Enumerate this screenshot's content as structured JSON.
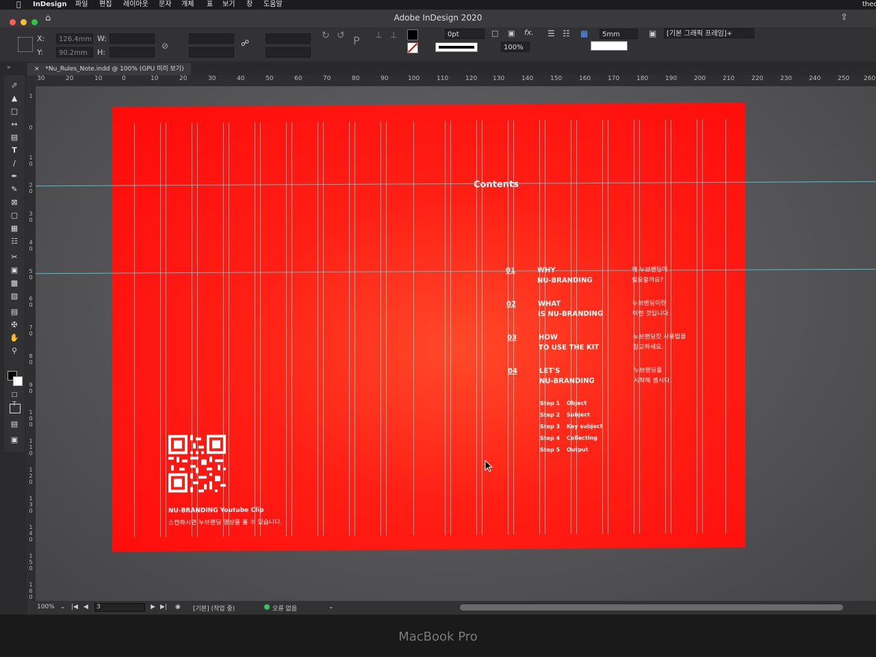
{
  "menubar": {
    "app": "InDesign",
    "items": [
      "파일",
      "편집",
      "레이아웃",
      "문자",
      "개체",
      "표",
      "보기",
      "창",
      "도움말"
    ],
    "right_text": "theo"
  },
  "window": {
    "title": "Adobe InDesign 2020"
  },
  "control": {
    "x_label": "X:",
    "x_value": "126.4mm",
    "y_label": "Y:",
    "y_value": "90.2mm",
    "w_label": "W:",
    "h_label": "H:",
    "stroke_weight": "0pt",
    "zoom": "100%",
    "gutter": "5mm",
    "style_select": "[기본 그래픽 프레임]+"
  },
  "tab": {
    "label": "*Nu_Rules_Note.indd @ 100% (GPU 미리 보기)",
    "close": "×"
  },
  "ruler": {
    "h_labels": [
      "30",
      "20",
      "10",
      "0",
      "10",
      "20",
      "30",
      "40",
      "50",
      "60",
      "70",
      "80",
      "90",
      "100",
      "110",
      "120",
      "130",
      "140",
      "150",
      "160",
      "170",
      "180",
      "190",
      "200",
      "210",
      "220",
      "230",
      "240",
      "250",
      "260"
    ],
    "v_labels": [
      "1",
      "0",
      "1 0",
      "2 0",
      "3 0",
      "4 0",
      "5 0",
      "6 0",
      "7 0",
      "8 0",
      "9 0",
      "1 0 0",
      "1 1 0",
      "1 2 0",
      "1 3 0",
      "1 4 0",
      "1 5 0",
      "1 6 0"
    ]
  },
  "page": {
    "contents_title": "Contents",
    "toc": [
      {
        "num": "01",
        "title1": "WHY",
        "title2": "NU-BRANDING",
        "desc1": "왜 누브랜딩이",
        "desc2": "필요할까요?"
      },
      {
        "num": "02",
        "title1": "WHAT",
        "title2": "IS NU-BRANDING",
        "desc1": "누브랜딩이란",
        "desc2": "이런 것입니다."
      },
      {
        "num": "03",
        "title1": "HOW",
        "title2": "TO USE THE KIT",
        "desc1": "누브랜딩킷 사용법을",
        "desc2": "참고하세요."
      },
      {
        "num": "04",
        "title1": "LET'S",
        "title2": "NU-BRANDING",
        "desc1": "누브랜딩을",
        "desc2": "시작해 봅시다."
      }
    ],
    "steps": [
      {
        "step": "Step 1",
        "name": "Object"
      },
      {
        "step": "Step 2",
        "name": "Subject"
      },
      {
        "step": "Step 3",
        "name": "Key subject"
      },
      {
        "step": "Step 4",
        "name": "Collecting"
      },
      {
        "step": "Step 5",
        "name": "Output"
      }
    ],
    "qr_caption": "NU-BRANDING Youtube Clip",
    "qr_subcaption": "스캔하시면 누브랜딩 영상을 볼 수 있습니다.",
    "bg_color": "#ff1e14"
  },
  "status": {
    "zoom": "100%",
    "page": "3",
    "profile": "[기본] (작업 중)",
    "errors": "오류 없음",
    "ok_color": "#35c759"
  },
  "laptop": {
    "brand": "MacBook Pro"
  }
}
